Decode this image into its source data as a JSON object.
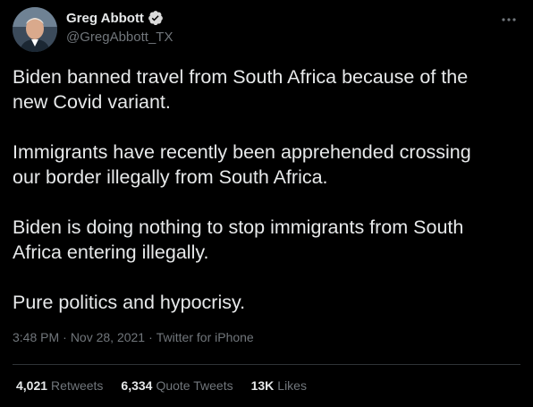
{
  "author": {
    "name": "Greg Abbott",
    "handle": "@GregAbbott_TX",
    "verified": true
  },
  "icons": {
    "verified": "verified-badge-icon",
    "more": "more-options-icon"
  },
  "tweet": {
    "paragraphs": [
      "Biden banned travel from South Africa because of the\nnew Covid variant.",
      "Immigrants have recently been apprehended crossing\nour border illegally from South Africa.",
      "Biden is doing nothing to stop immigrants from South\nAfrica entering illegally.",
      "Pure politics and hypocrisy."
    ],
    "time": "3:48 PM",
    "date": "Nov 28, 2021",
    "source": "Twitter for iPhone",
    "separator": "·"
  },
  "stats": [
    {
      "count": "4,021",
      "label": "Retweets"
    },
    {
      "count": "6,334",
      "label": "Quote Tweets"
    },
    {
      "count": "13K",
      "label": "Likes"
    }
  ],
  "colors": {
    "background": "#000000",
    "text": "#e7e9ea",
    "secondary": "#71767b",
    "verified": "#1d9bf0",
    "divider": "#2f3336"
  }
}
